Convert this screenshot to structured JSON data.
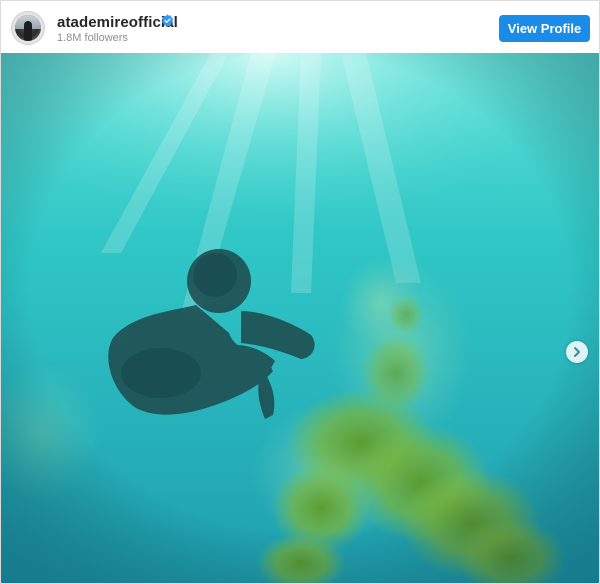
{
  "header": {
    "username": "atademireofficial",
    "followers": "1.8M followers",
    "view_profile_label": "View Profile"
  },
  "icons": {
    "avatar": "profile-avatar",
    "verified": "verified-badge-icon",
    "next": "chevron-right-icon"
  },
  "colors": {
    "accent": "#1a8ce8",
    "verified": "#3897f0",
    "water": "#2ec2c0"
  }
}
